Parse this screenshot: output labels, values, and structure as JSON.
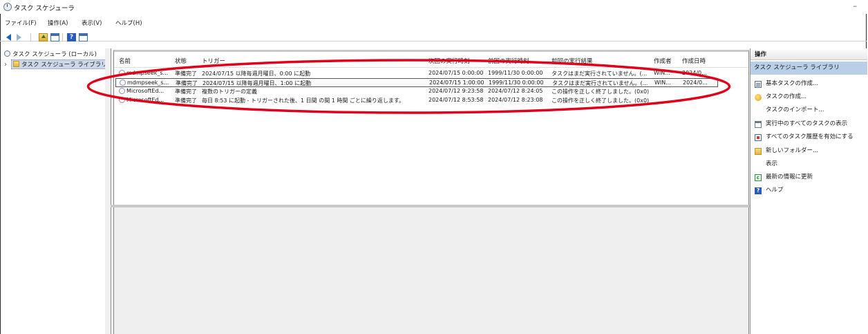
{
  "window": {
    "title": "タスク スケジューラ",
    "minimize_glyph": "–"
  },
  "menu": [
    "ファイル(F)",
    "操作(A)",
    "表示(V)",
    "ヘルプ(H)"
  ],
  "toolbar": {
    "help_glyph": "?"
  },
  "tree": {
    "root": "タスク スケジューラ (ローカル)",
    "expander": "›",
    "library": "タスク スケジューラ ライブラリ"
  },
  "columns": {
    "name": "名前",
    "status": "状態",
    "trigger": "トリガー",
    "next_run": "次回の実行時刻",
    "last_run": "前回の実行時刻",
    "last_result": "前回の実行結果",
    "author": "作成者",
    "created": "作成日時"
  },
  "tasks": [
    {
      "name": "mdmpseek_s...",
      "status": "準備完了",
      "trigger": "2024/07/15 以降毎週月曜日、0:00 に起動",
      "next_run": "2024/07/15 0:00:00",
      "last_run": "1999/11/30 0:00:00",
      "last_result": "タスクはまだ実行されていません。(...",
      "author": "WIN...",
      "created": "2024/0..."
    },
    {
      "name": "mdmpseek_s...",
      "status": "準備完了",
      "trigger": "2024/07/15 以降毎週月曜日、1:00 に起動",
      "next_run": "2024/07/15 1:00:00",
      "last_run": "1999/11/30 0:00:00",
      "last_result": "タスクはまだ実行されていません。(...",
      "author": "WIN...",
      "created": "2024/0..."
    },
    {
      "name": "MicrosoftEd...",
      "status": "準備完了",
      "trigger": "複数のトリガーの定義",
      "next_run": "2024/07/12 9:23:58",
      "last_run": "2024/07/12 8:24:05",
      "last_result": "この操作を正しく終了しました。(0x0)",
      "author": "",
      "created": ""
    },
    {
      "name": "MicrosoftEd...",
      "status": "準備完了",
      "trigger": "毎日 8:53 に起動 - トリガーされた後、1 日間 の間 1 時間 ごとに繰り返します。",
      "next_run": "2024/07/12 8:53:58",
      "last_run": "2024/07/12 8:23:08",
      "last_result": "この操作を正しく終了しました。(0x0)",
      "author": "",
      "created": ""
    }
  ],
  "actions": {
    "title": "操作",
    "section": "タスク スケジューラ ライブラリ",
    "items": [
      {
        "label": "基本タスクの作成...",
        "icon": "wizard-icon"
      },
      {
        "label": "タスクの作成...",
        "icon": "create-task-icon"
      },
      {
        "label": "タスクのインポート...",
        "icon": ""
      },
      {
        "label": "実行中のすべてのタスクの表示",
        "icon": "running-tasks-icon"
      },
      {
        "label": "すべてのタスク履歴を有効にする",
        "icon": "history-icon"
      },
      {
        "label": "新しいフォルダー...",
        "icon": "folder-icon"
      },
      {
        "label": "表示",
        "icon": ""
      },
      {
        "label": "最新の情報に更新",
        "icon": "refresh-icon"
      },
      {
        "label": "ヘルプ",
        "icon": "help-icon"
      }
    ]
  },
  "colors": {
    "selection": "#b9cfe7",
    "annotation": "#e0001b",
    "toolbar_arrow": "#1a62b8"
  }
}
